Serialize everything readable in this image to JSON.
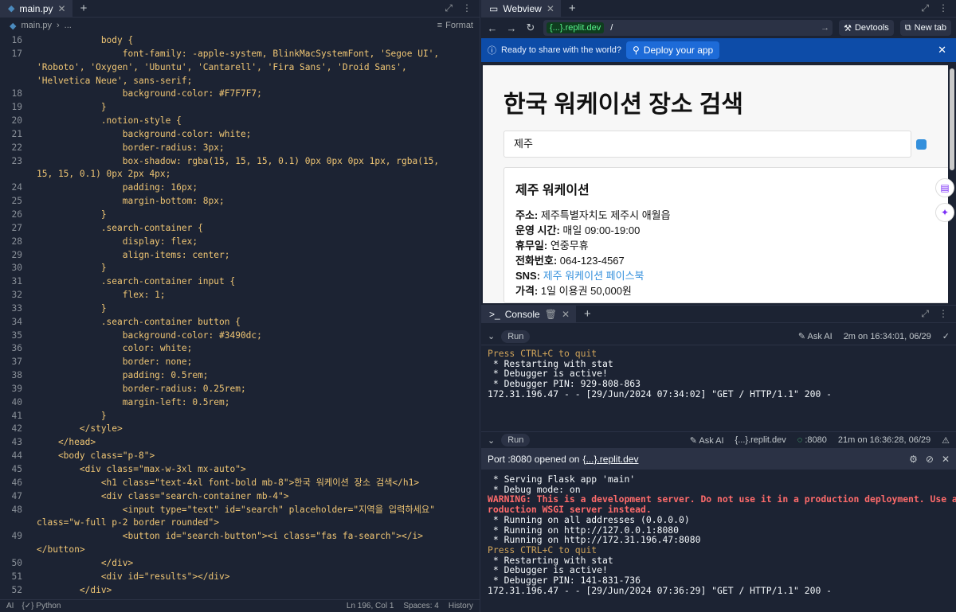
{
  "editor": {
    "tab_label": "main.py",
    "breadcrumb_file": "main.py",
    "breadcrumb_more": "...",
    "format_label": "Format",
    "lines": [
      {
        "n": "16",
        "t": "            body {"
      },
      {
        "n": "17",
        "t": "                font-family: -apple-system, BlinkMacSystemFont, 'Segoe UI',"
      },
      {
        "n": "",
        "t": "'Roboto', 'Oxygen', 'Ubuntu', 'Cantarell', 'Fira Sans', 'Droid Sans',"
      },
      {
        "n": "",
        "t": "'Helvetica Neue', sans-serif;"
      },
      {
        "n": "18",
        "t": "                background-color: #F7F7F7;"
      },
      {
        "n": "19",
        "t": "            }"
      },
      {
        "n": "20",
        "t": "            .notion-style {"
      },
      {
        "n": "21",
        "t": "                background-color: white;"
      },
      {
        "n": "22",
        "t": "                border-radius: 3px;"
      },
      {
        "n": "23",
        "t": "                box-shadow: rgba(15, 15, 15, 0.1) 0px 0px 0px 1px, rgba(15,"
      },
      {
        "n": "",
        "t": "15, 15, 0.1) 0px 2px 4px;"
      },
      {
        "n": "24",
        "t": "                padding: 16px;"
      },
      {
        "n": "25",
        "t": "                margin-bottom: 8px;"
      },
      {
        "n": "26",
        "t": "            }"
      },
      {
        "n": "27",
        "t": "            .search-container {"
      },
      {
        "n": "28",
        "t": "                display: flex;"
      },
      {
        "n": "29",
        "t": "                align-items: center;"
      },
      {
        "n": "30",
        "t": "            }"
      },
      {
        "n": "31",
        "t": "            .search-container input {"
      },
      {
        "n": "32",
        "t": "                flex: 1;"
      },
      {
        "n": "33",
        "t": "            }"
      },
      {
        "n": "34",
        "t": "            .search-container button {"
      },
      {
        "n": "35",
        "t": "                background-color: #3490dc;"
      },
      {
        "n": "36",
        "t": "                color: white;"
      },
      {
        "n": "37",
        "t": "                border: none;"
      },
      {
        "n": "38",
        "t": "                padding: 0.5rem;"
      },
      {
        "n": "39",
        "t": "                border-radius: 0.25rem;"
      },
      {
        "n": "40",
        "t": "                margin-left: 0.5rem;"
      },
      {
        "n": "41",
        "t": "            }"
      },
      {
        "n": "42",
        "t": "        </style>"
      },
      {
        "n": "43",
        "t": "    </head>"
      },
      {
        "n": "44",
        "t": "    <body class=\"p-8\">"
      },
      {
        "n": "45",
        "t": "        <div class=\"max-w-3xl mx-auto\">"
      },
      {
        "n": "46",
        "t": "            <h1 class=\"text-4xl font-bold mb-8\">한국 워케이션 장소 검색</h1>"
      },
      {
        "n": "47",
        "t": "            <div class=\"search-container mb-4\">"
      },
      {
        "n": "48",
        "t": "                <input type=\"text\" id=\"search\" placeholder=\"지역을 입력하세요\""
      },
      {
        "n": "",
        "t": "class=\"w-full p-2 border rounded\">"
      },
      {
        "n": "49",
        "t": "                <button id=\"search-button\"><i class=\"fas fa-search\"></i>"
      },
      {
        "n": "",
        "t": "</button>"
      },
      {
        "n": "50",
        "t": "            </div>"
      },
      {
        "n": "51",
        "t": "            <div id=\"results\"></div>"
      },
      {
        "n": "52",
        "t": "        </div>"
      }
    ],
    "status_ai": "AI",
    "status_lang": "Python",
    "status_pos": "Ln 196, Col 1",
    "status_spaces": "Spaces: 4",
    "status_history": "History"
  },
  "webview": {
    "tab_label": "Webview",
    "url_domain": "{...}.replit.dev",
    "url_path": "/",
    "devtools_label": "Devtools",
    "newtab_label": "New tab",
    "deploy_prompt": "Ready to share with the world?",
    "deploy_button": "Deploy your app",
    "page_title": "한국 워케이션 장소 검색",
    "search_value": "제주",
    "card": {
      "title": "제주 워케이션",
      "address_label": "주소:",
      "address": "제주특별자치도 제주시 애월읍",
      "hours_label": "운영 시간:",
      "hours": "매일 09:00-19:00",
      "closed_label": "휴무일:",
      "closed": "연중무휴",
      "phone_label": "전화번호:",
      "phone": "064-123-4567",
      "sns_label": "SNS:",
      "sns": "제주 워케이션 페이스북",
      "price_label": "가격:",
      "price": "1일 이용권 50,000원"
    }
  },
  "console": {
    "tab_label": "Console",
    "run_label": "Run",
    "ask_ai": "Ask AI",
    "run1_time": "2m on 16:34:01, 06/29",
    "run1_lines": [
      {
        "c": "y",
        "t": "Press CTRL+C to quit"
      },
      {
        "c": "",
        "t": " * Restarting with stat"
      },
      {
        "c": "",
        "t": " * Debugger is active!"
      },
      {
        "c": "",
        "t": " * Debugger PIN: 929-808-863"
      },
      {
        "c": "",
        "t": "172.31.196.47 - - [29/Jun/2024 07:34:02] \"GET / HTTP/1.1\" 200 -"
      }
    ],
    "run2_domain": "{...}.replit.dev",
    "run2_port": ":8080",
    "run2_time": "21m on 16:36:28, 06/29",
    "port_text": "Port :8080 opened on ",
    "port_domain": "{...}.replit.dev",
    "run2_lines": [
      {
        "c": "",
        "t": " * Serving Flask app 'main'"
      },
      {
        "c": "",
        "t": " * Debug mode: on"
      },
      {
        "c": "w",
        "t": "WARNING: This is a development server. Do not use it in a production deployment. Use a p"
      },
      {
        "c": "w",
        "t": "roduction WSGI server instead."
      },
      {
        "c": "",
        "t": " * Running on all addresses (0.0.0.0)"
      },
      {
        "c": "",
        "t": " * Running on http://127.0.0.1:8080"
      },
      {
        "c": "",
        "t": " * Running on http://172.31.196.47:8080"
      },
      {
        "c": "y",
        "t": "Press CTRL+C to quit"
      },
      {
        "c": "",
        "t": " * Restarting with stat"
      },
      {
        "c": "",
        "t": " * Debugger is active!"
      },
      {
        "c": "",
        "t": " * Debugger PIN: 141-831-736"
      },
      {
        "c": "",
        "t": "172.31.196.47 - - [29/Jun/2024 07:36:29] \"GET / HTTP/1.1\" 200 -"
      }
    ]
  }
}
